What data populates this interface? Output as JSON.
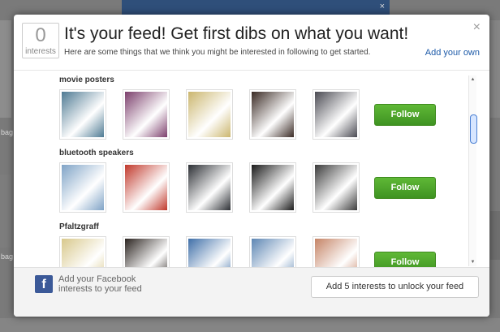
{
  "modal": {
    "interest_count": "0",
    "interest_count_label": "interests",
    "title": "It's your feed! Get first dibs on what you want!",
    "subtitle": "Here are some things that we think you might be interested in following to get started.",
    "add_own_link": "Add your own",
    "close_icon": "×"
  },
  "categories": [
    {
      "name": "movie posters",
      "follow_label": "Follow",
      "thumb_colors": [
        "#4e7a93",
        "#7c3f6c",
        "#cbb66e",
        "#3a2a24",
        "#4a4a52"
      ]
    },
    {
      "name": "bluetooth speakers",
      "follow_label": "Follow",
      "thumb_colors": [
        "#7fa3c6",
        "#c0382b",
        "#2c2f34",
        "#1a1a1a",
        "#3b3b3b"
      ]
    },
    {
      "name": "Pfaltzgraff",
      "follow_label": "Follow",
      "thumb_colors": [
        "#d8c88c",
        "#2b2420",
        "#3f6fa8",
        "#5d86b3",
        "#c58466"
      ]
    }
  ],
  "footer": {
    "facebook_text": "Add your Facebook interests to your feed",
    "unlock_button": "Add 5 interests to unlock your feed"
  },
  "background": {
    "label_1": "bag",
    "label_2": "bag"
  },
  "colors": {
    "follow_green": "#4ea52b",
    "link_blue": "#1d5aa8",
    "facebook_blue": "#3b5998"
  }
}
